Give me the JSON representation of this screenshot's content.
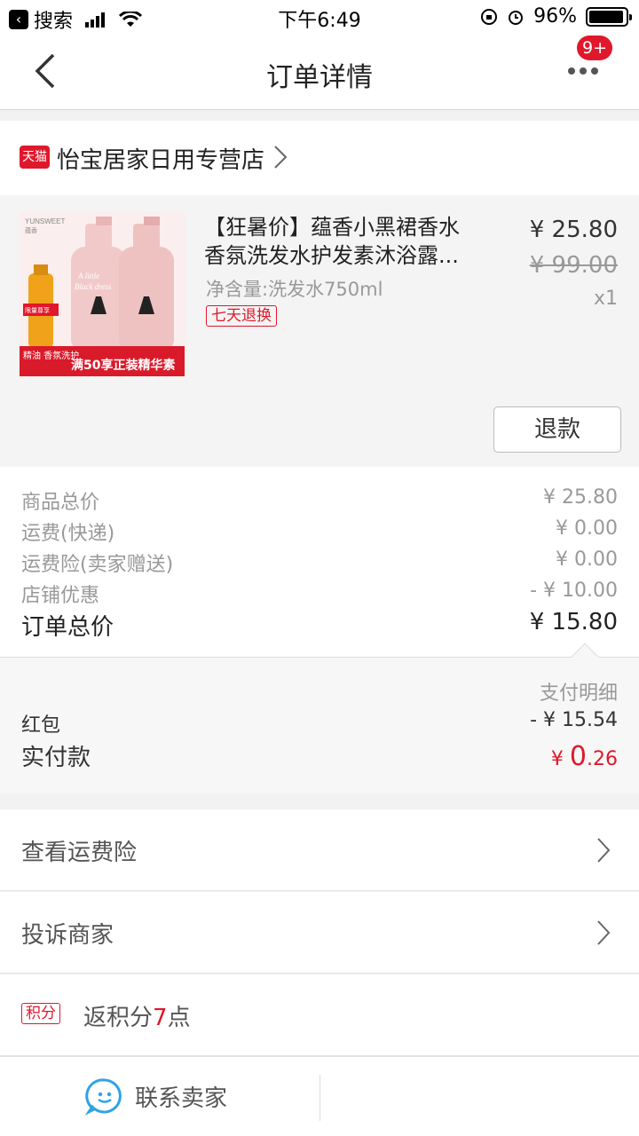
{
  "status_bar": {
    "back_app": "搜索",
    "time": "下午6:49",
    "battery_percent_label": "96%",
    "battery_level": 0.96
  },
  "nav": {
    "title": "订单详情",
    "badge": "9+"
  },
  "store": {
    "platform_tag": "天猫",
    "name": "怡宝居家日用专营店"
  },
  "product": {
    "title_line1": "【狂暑价】蕴香小黑裙香水",
    "title_line2": "香氛洗发水护发素沐浴露...",
    "spec": "净含量:洗发水750ml",
    "tag": "七天退换",
    "price": "¥ 25.80",
    "original_price": "¥ 99.00",
    "quantity": "x1",
    "refund_button": "退款",
    "image_text": {
      "brand": "YUNSWEET",
      "brand_cn": "蕴香",
      "script_line1": "A little",
      "script_line2": "Black dress",
      "promo_badge": "限量尊享",
      "promo_left": "精油 香氛洗护",
      "promo_main": "满50享正装精华素"
    }
  },
  "summary": {
    "rows": [
      {
        "label": "商品总价",
        "value": "¥ 25.80"
      },
      {
        "label": "运费(快递)",
        "value": "¥ 0.00"
      },
      {
        "label": "运费险(卖家赠送)",
        "value": "¥ 0.00"
      },
      {
        "label": "店铺优惠",
        "value": "- ¥ 10.00"
      }
    ],
    "total_label": "订单总价",
    "total_value": "¥ 15.80"
  },
  "payment": {
    "detail_link": "支付明细",
    "red_packet_label": "红包",
    "red_packet_value": "- ¥ 15.54",
    "paid_label": "实付款",
    "paid_currency": "¥ ",
    "paid_int": "0",
    "paid_dec": ".26"
  },
  "list": {
    "freight_insurance": "查看运费险",
    "complain": "投诉商家",
    "points_tag": "积分",
    "points_prefix": "返积分",
    "points_num": "7",
    "points_suffix": "点"
  },
  "bottom": {
    "contact_seller": "联系卖家"
  },
  "colors": {
    "accent": "#e0182b",
    "chat_icon": "#2fa3e6"
  }
}
